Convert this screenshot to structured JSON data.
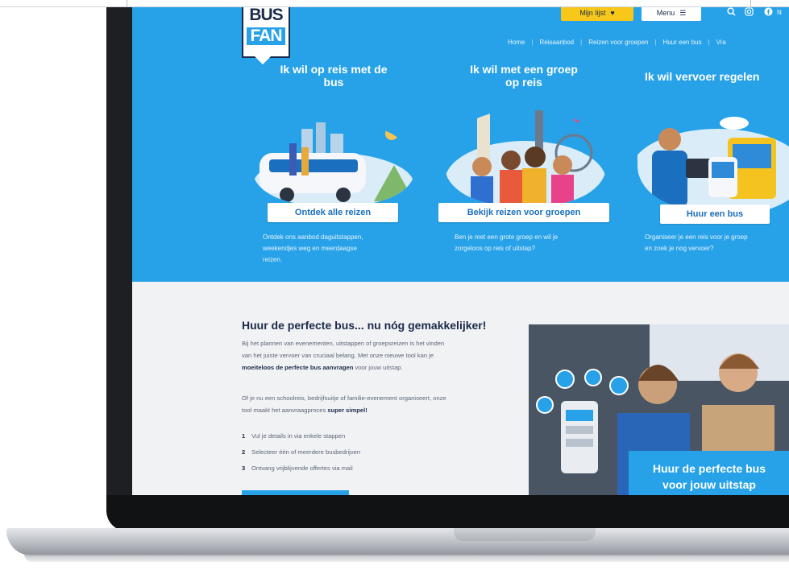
{
  "header": {
    "logo_line1": "BUS",
    "logo_line2": "FAN",
    "wishlist_label": "Mijn lijst",
    "menu_label": "Menu",
    "icons": [
      "search-icon",
      "instagram-icon",
      "facebook-icon"
    ],
    "cut_text": "N"
  },
  "nav": {
    "items": [
      "Home",
      "Reisaanbod",
      "Reizen voor groepen",
      "Huur een bus",
      "Vra"
    ]
  },
  "columns": [
    {
      "title_line1": "Ik wil op reis met de",
      "title_line2": "bus",
      "cta": "Ontdek alle reizen",
      "desc_line1": "Ontdek ons aanbod daguitstappen,",
      "desc_line2": "weekendjes weg en meerdaagse",
      "desc_line3": "reizen."
    },
    {
      "title_line1": "Ik wil met een groep",
      "title_line2": "op reis",
      "cta": "Bekijk reizen voor groepen",
      "desc_line1": "Ben je met een grote groep en wil je",
      "desc_line2": "zorgeloos op reis of uitstap?"
    },
    {
      "title_line1": "Ik wil vervoer regelen",
      "cta": "Huur een bus",
      "desc_line1": "Organiseer je een reis voor je groep",
      "desc_line2": "en zoek je nog vervoer?"
    }
  ],
  "promo": {
    "title": "Huur de perfecte bus... nu nóg gemakkelijker!",
    "para1_a": "Bij het plannen van evenementen, uitstappen of groepsreizen is het vinden",
    "para1_b": "van het juiste vervoer van cruciaal belang. Met onze nieuwe tool kan je",
    "para1_c_bold": "moeiteloos de perfecte bus aanvragen",
    "para1_c_rest": " voor jouw uitstap.",
    "para2_a": "Of je nu een schoolreis, bedrijfsuitje of familie-evenement organiseert, onze",
    "para2_b": "tool maakt het aanvraagproces ",
    "para2_b_bold": "super simpel!",
    "steps": [
      {
        "n": "1",
        "text": "Vul je details in via enkele stappen"
      },
      {
        "n": "2",
        "text": "Selecteer één of meerdere busbedrijven"
      },
      {
        "n": "3",
        "text": "Ontvang vrijblijvende offertes via mail"
      }
    ],
    "photo_caption_line1": "Huur de perfecte bus",
    "photo_caption_line2": "voor jouw uitstap"
  },
  "colors": {
    "brand_blue": "#27a2e8",
    "navy": "#1b2a4a",
    "yellow": "#f7c71a"
  }
}
